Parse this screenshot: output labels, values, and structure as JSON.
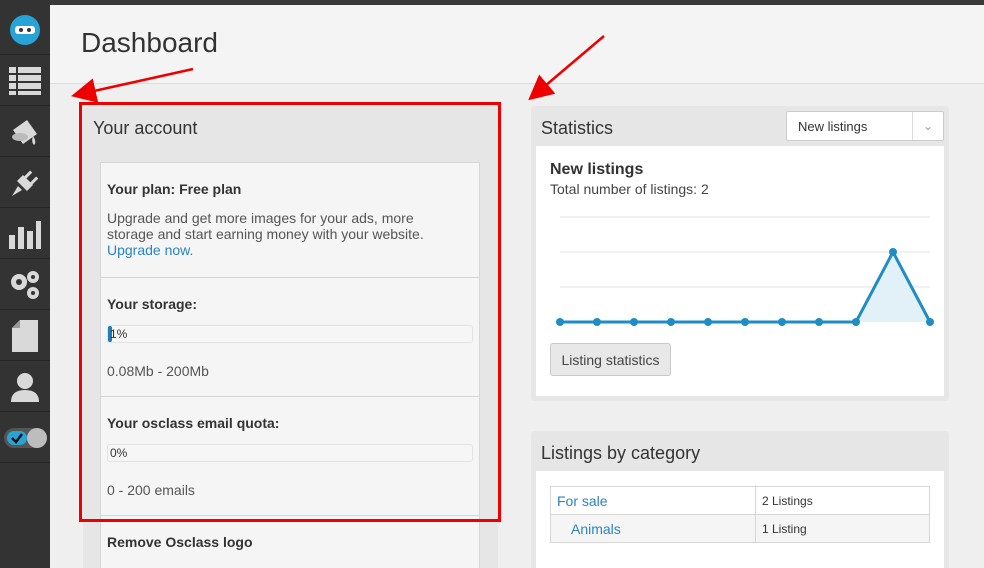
{
  "header": {
    "title": "Dashboard"
  },
  "sidebar": {
    "items": [
      {
        "icon": "osclass-logo-icon"
      },
      {
        "icon": "listings-icon"
      },
      {
        "icon": "appearance-icon"
      },
      {
        "icon": "plugins-icon"
      },
      {
        "icon": "statistics-icon"
      },
      {
        "icon": "settings-icon"
      },
      {
        "icon": "pages-icon"
      },
      {
        "icon": "users-icon"
      },
      {
        "icon": "toggle-icon"
      }
    ]
  },
  "account": {
    "title": "Your account",
    "plan_label": "Your plan: Free plan",
    "plan_text": "Upgrade and get more images for your ads, more storage and start earning money with your website.",
    "upgrade_link": "Upgrade now.",
    "storage_label": "Your storage:",
    "storage_percent": "1%",
    "storage_fraction": 0.01,
    "storage_text": "0.08Mb - 200Mb",
    "quota_label": "Your osclass email quota:",
    "quota_percent": "0%",
    "quota_fraction": 0,
    "quota_text": "0 - 200 emails",
    "remove_logo_label": "Remove Osclass logo"
  },
  "statistics": {
    "title": "Statistics",
    "select_value": "New listings",
    "chart_title": "New listings",
    "chart_subtitle": "Total number of listings: 2",
    "button_label": "Listing statistics",
    "color": "#1f8dc4"
  },
  "chart_data": {
    "type": "area",
    "title": "New listings",
    "xlabel": "",
    "ylabel": "",
    "x": [
      1,
      2,
      3,
      4,
      5,
      6,
      7,
      8,
      9,
      10,
      11
    ],
    "values": [
      0,
      0,
      0,
      0,
      0,
      0,
      0,
      0,
      0,
      2,
      0
    ],
    "ylim": [
      0,
      3
    ],
    "grid": true
  },
  "category": {
    "title": "Listings by category",
    "rows": [
      {
        "name": "For sale",
        "count": "2 Listings"
      },
      {
        "name": "Animals",
        "count": "1 Listing"
      }
    ]
  }
}
